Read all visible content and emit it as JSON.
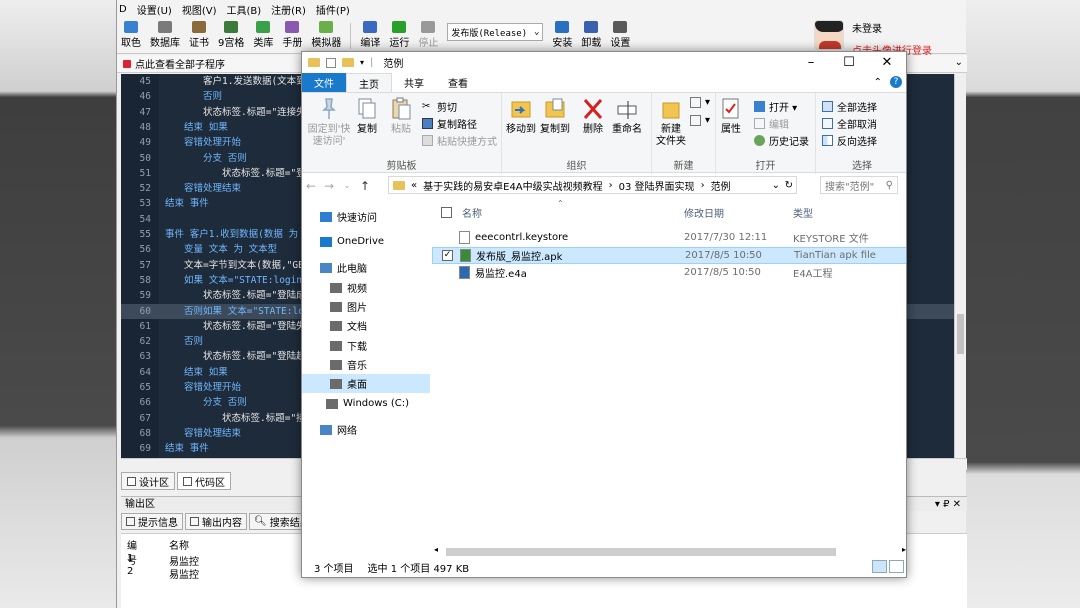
{
  "ide": {
    "menu": [
      "D",
      "设置(U)",
      "视图(V)",
      "工具(B)",
      "注册(R)",
      "插件(P)"
    ],
    "toolbar": [
      "取色",
      "数据库",
      "证书",
      "9宫格",
      "类库",
      "手册",
      "模拟器",
      "编译",
      "运行",
      "停止",
      "安装",
      "卸载",
      "设置"
    ],
    "release_select": "发布版(Release)",
    "login": {
      "status": "未登录",
      "hint": "点击头像进行登录"
    },
    "code_header": "点此查看全部子程序",
    "code_lines": [
      {
        "n": "45",
        "indent": 2,
        "text": "客户1.发送数据(文本到",
        "cls": "fn"
      },
      {
        "n": "46",
        "indent": 2,
        "text": "否则",
        "cls": "kw"
      },
      {
        "n": "47",
        "indent": 2,
        "text": "状态标签.标题=\"连接失",
        "cls": "fn"
      },
      {
        "n": "48",
        "indent": 1,
        "text": "结束 如果",
        "cls": "kw"
      },
      {
        "n": "49",
        "indent": 1,
        "text": "容错处理开始",
        "cls": "kw"
      },
      {
        "n": "50",
        "indent": 2,
        "text": "分支 否则",
        "cls": "kw"
      },
      {
        "n": "51",
        "indent": 3,
        "text": "状态标签.标题=\"登",
        "cls": "fn"
      },
      {
        "n": "52",
        "indent": 1,
        "text": "容错处理结束",
        "cls": "kw"
      },
      {
        "n": "53",
        "indent": 0,
        "text": "结束 事件",
        "cls": "kw"
      },
      {
        "n": "54",
        "indent": 0,
        "text": "",
        "cls": "fn"
      },
      {
        "n": "55",
        "indent": 0,
        "text": "事件 客户1.收到数据(数据 为 ",
        "cls": "kw"
      },
      {
        "n": "56",
        "indent": 1,
        "text": "变量 文本 为 文本型",
        "cls": "kw"
      },
      {
        "n": "57",
        "indent": 1,
        "text": "文本=字节到文本(数据,\"GB",
        "cls": "fn"
      },
      {
        "n": "58",
        "indent": 1,
        "text": "如果 文本=\"STATE:login-s",
        "cls": "kw"
      },
      {
        "n": "59",
        "indent": 2,
        "text": "状态标签.标题=\"登陆成",
        "cls": "fn"
      },
      {
        "n": "60",
        "indent": 1,
        "text": "否则如果 文本=\"STATE:logi",
        "cls": "kw"
      },
      {
        "n": "61",
        "indent": 2,
        "text": "状态标签.标题=\"登陆失",
        "cls": "fn"
      },
      {
        "n": "62",
        "indent": 1,
        "text": "否则",
        "cls": "kw"
      },
      {
        "n": "63",
        "indent": 2,
        "text": "状态标签.标题=\"登陆超",
        "cls": "fn"
      },
      {
        "n": "64",
        "indent": 1,
        "text": "结束 如果",
        "cls": "kw"
      },
      {
        "n": "65",
        "indent": 1,
        "text": "容错处理开始",
        "cls": "kw"
      },
      {
        "n": "66",
        "indent": 2,
        "text": "分支 否则",
        "cls": "kw"
      },
      {
        "n": "67",
        "indent": 3,
        "text": "状态标签.标题=\"接",
        "cls": "fn"
      },
      {
        "n": "68",
        "indent": 1,
        "text": "容错处理结束",
        "cls": "kw"
      },
      {
        "n": "69",
        "indent": 0,
        "text": "结束 事件",
        "cls": "kw"
      }
    ],
    "bottom_tabs": [
      "设计区",
      "代码区"
    ],
    "output_title": "输出区",
    "output_pin": "▾ ₽ ✕",
    "output_tabs": [
      "提示信息",
      "输出内容",
      "搜索结果"
    ],
    "output_columns": [
      "编号",
      "名称"
    ],
    "output_rows": [
      [
        "1",
        "易监控"
      ],
      [
        "2",
        "易监控"
      ]
    ]
  },
  "explorer": {
    "title": "范例",
    "ribbon_tabs": [
      "文件",
      "主页",
      "共享",
      "查看"
    ],
    "clipboard": {
      "label": "剪贴板",
      "pin": "固定到'快\n速访问'",
      "copy": "复制",
      "paste": "粘贴",
      "cut": "剪切",
      "copy_path": "复制路径",
      "paste_shortcut": "粘贴快捷方式"
    },
    "organize": {
      "label": "组织",
      "move": "移动到",
      "copyto": "复制到",
      "delete": "删除",
      "rename": "重命名"
    },
    "new": {
      "label": "新建",
      "folder": "新建\n文件夹"
    },
    "open": {
      "label": "打开",
      "props": "属性",
      "open": "打开 ▾",
      "edit": "编辑",
      "history": "历史记录"
    },
    "select": {
      "label": "选择",
      "all": "全部选择",
      "none": "全部取消",
      "invert": "反向选择"
    },
    "address": [
      "«",
      "基于实践的易安卓E4A中级实战视频教程",
      "›",
      "03 登陆界面实现",
      "›",
      "范例"
    ],
    "search_placeholder": "搜索\"范例\"",
    "nav": [
      {
        "label": "快速访问",
        "color": "#2f7fd0"
      },
      {
        "label": "OneDrive",
        "color": "#1979ca"
      },
      {
        "label": "此电脑",
        "color": "#4a86c5"
      },
      {
        "label": "视频",
        "color": "#6b6b6b"
      },
      {
        "label": "图片",
        "color": "#6b6b6b"
      },
      {
        "label": "文档",
        "color": "#6b6b6b"
      },
      {
        "label": "下载",
        "color": "#6b6b6b"
      },
      {
        "label": "音乐",
        "color": "#6b6b6b"
      },
      {
        "label": "桌面",
        "color": "#6b6b6b"
      },
      {
        "label": "Windows (C:)",
        "color": "#6b6b6b"
      },
      {
        "label": "网络",
        "color": "#4a86c5"
      }
    ],
    "columns": [
      "名称",
      "修改日期",
      "类型"
    ],
    "files": [
      {
        "name": "eeecontrl.keystore",
        "date": "2017/7/30 12:11",
        "type": "KEYSTORE 文件"
      },
      {
        "name": "发布版_易监控.apk",
        "date": "2017/8/5 10:50",
        "type": "TianTian apk file"
      },
      {
        "name": "易监控.e4a",
        "date": "2017/8/5 10:50",
        "type": "E4A工程"
      }
    ],
    "status": {
      "count": "3 个项目",
      "selected": "选中 1 个项目  497 KB"
    }
  }
}
